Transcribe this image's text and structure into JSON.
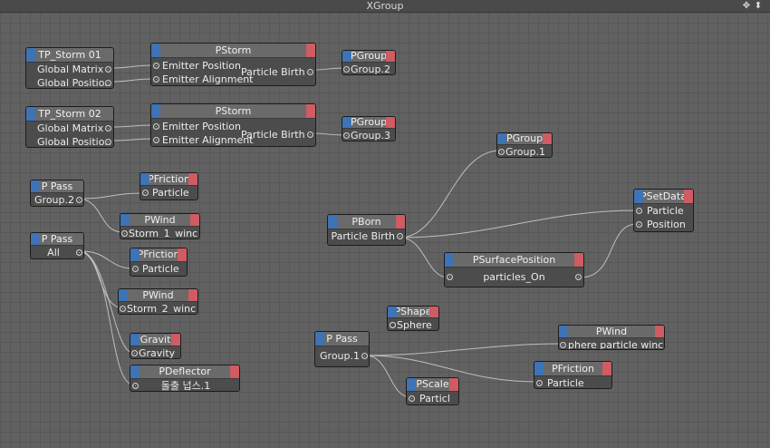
{
  "window": {
    "title": "XGroup"
  },
  "title_icons": [
    {
      "name": "move-icon",
      "glyph": "✥"
    },
    {
      "name": "collapse-icon",
      "glyph": "⬍"
    }
  ],
  "colors": {
    "input_corner": "#3e73b5",
    "output_corner": "#cf5b63",
    "node_body": "#4c4c4c",
    "canvas": "#616161"
  },
  "nodes": {
    "tp_storm_01": {
      "title": "TP_Storm 01",
      "ports": [
        "Global Matrix",
        "Global Position"
      ]
    },
    "pstorm_1": {
      "title": "PStorm",
      "inputs": [
        "Emitter Position",
        "Emitter Alignment"
      ],
      "output": "Particle Birth"
    },
    "pgroup_2": {
      "title": "PGroup",
      "value": "Group.2"
    },
    "tp_storm_02": {
      "title": "TP_Storm 02",
      "ports": [
        "Global Matrix",
        "Global Position"
      ]
    },
    "pstorm_2": {
      "title": "PStorm",
      "inputs": [
        "Emitter Position",
        "Emitter Alignment"
      ],
      "output": "Particle Birth"
    },
    "pgroup_3": {
      "title": "PGroup",
      "value": "Group.3"
    },
    "pgroup_1": {
      "title": "PGroup",
      "value": "Group.1"
    },
    "ppass_group2": {
      "title": "P Pass",
      "value": "Group.2"
    },
    "pfriction_1": {
      "title": "PFriction",
      "value": "Particle"
    },
    "pwind_1": {
      "title": "PWind",
      "value": "Storm_1_winc"
    },
    "ppass_all": {
      "title": "P Pass",
      "value": "All"
    },
    "pfriction_2": {
      "title": "PFriction",
      "value": "Particle"
    },
    "pwind_2": {
      "title": "PWind",
      "value": "Storm_2_winc"
    },
    "pgravity": {
      "title": "PGravity",
      "value": "Gravity"
    },
    "pdeflector": {
      "title": "PDeflector",
      "value": "돌출 넙스.1"
    },
    "pborn": {
      "title": "PBorn",
      "value": "Particle Birth"
    },
    "psetdata": {
      "title": "PSetData",
      "ports": [
        "Particle",
        "Position"
      ]
    },
    "psurfaceposition": {
      "title": "PSurfacePosition",
      "value": "particles_On"
    },
    "pshape": {
      "title": "PShape",
      "value": "Sphere"
    },
    "ppass_group1": {
      "title": "P Pass",
      "value": "Group.1"
    },
    "pwind_3": {
      "title": "PWind",
      "value": "phere particle winc"
    },
    "pfriction_3": {
      "title": "PFriction",
      "value": "Particle"
    },
    "pscale": {
      "title": "PScale",
      "value": "Particl"
    }
  }
}
